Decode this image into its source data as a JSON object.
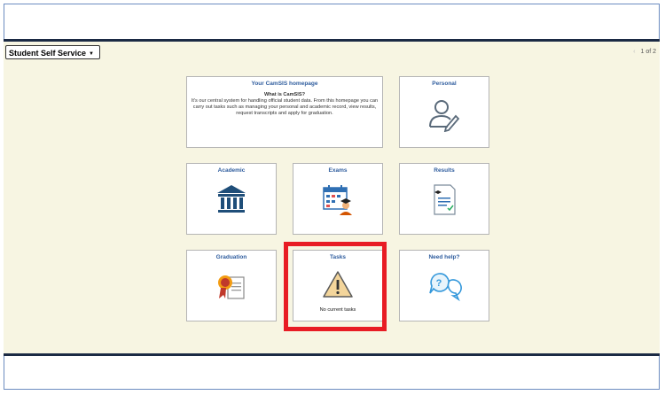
{
  "header": {
    "selector_label": "Student Self Service",
    "selector_icon": "caret-down-icon",
    "pager_text": "1 of 2"
  },
  "tiles": {
    "homepage": {
      "title": "Your CamSIS homepage",
      "question": "What is CamSIS?",
      "body": "It's our central system for handling official student data. From this homepage you can carry out tasks such as managing your personal and academic record, view results, request transcripts and apply for graduation."
    },
    "personal": {
      "title": "Personal",
      "icon": "user-edit-icon"
    },
    "academic": {
      "title": "Academic",
      "icon": "institution-icon"
    },
    "exams": {
      "title": "Exams",
      "icon": "calendar-graduate-icon"
    },
    "results": {
      "title": "Results",
      "icon": "results-document-icon"
    },
    "graduation": {
      "title": "Graduation",
      "icon": "certificate-icon"
    },
    "tasks": {
      "title": "Tasks",
      "icon": "warning-icon",
      "note": "No current tasks"
    },
    "help": {
      "title": "Need help?",
      "icon": "help-bubbles-icon"
    }
  },
  "colors": {
    "accent": "#2f5d9e",
    "highlight": "#e81c24",
    "background": "#f7f5e2"
  }
}
